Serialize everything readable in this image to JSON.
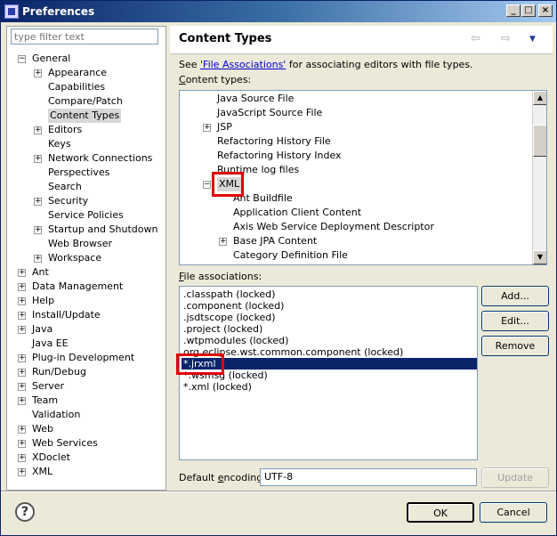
{
  "window": {
    "title": "Preferences",
    "controls": {
      "minimize": "_",
      "maximize": "□",
      "close": "×"
    }
  },
  "filter": {
    "placeholder": "type filter text"
  },
  "tree": [
    {
      "label": "General",
      "level": 0,
      "expander": "−"
    },
    {
      "label": "Appearance",
      "level": 1,
      "expander": "+"
    },
    {
      "label": "Capabilities",
      "level": 1,
      "expander": ""
    },
    {
      "label": "Compare/Patch",
      "level": 1,
      "expander": ""
    },
    {
      "label": "Content Types",
      "level": 1,
      "expander": "",
      "selected": true
    },
    {
      "label": "Editors",
      "level": 1,
      "expander": "+"
    },
    {
      "label": "Keys",
      "level": 1,
      "expander": ""
    },
    {
      "label": "Network Connections",
      "level": 1,
      "expander": "+"
    },
    {
      "label": "Perspectives",
      "level": 1,
      "expander": ""
    },
    {
      "label": "Search",
      "level": 1,
      "expander": ""
    },
    {
      "label": "Security",
      "level": 1,
      "expander": "+"
    },
    {
      "label": "Service Policies",
      "level": 1,
      "expander": ""
    },
    {
      "label": "Startup and Shutdown",
      "level": 1,
      "expander": "+"
    },
    {
      "label": "Web Browser",
      "level": 1,
      "expander": ""
    },
    {
      "label": "Workspace",
      "level": 1,
      "expander": "+"
    },
    {
      "label": "Ant",
      "level": 0,
      "expander": "+"
    },
    {
      "label": "Data Management",
      "level": 0,
      "expander": "+"
    },
    {
      "label": "Help",
      "level": 0,
      "expander": "+"
    },
    {
      "label": "Install/Update",
      "level": 0,
      "expander": "+"
    },
    {
      "label": "Java",
      "level": 0,
      "expander": "+"
    },
    {
      "label": "Java EE",
      "level": 0,
      "expander": ""
    },
    {
      "label": "Plug-in Development",
      "level": 0,
      "expander": "+"
    },
    {
      "label": "Run/Debug",
      "level": 0,
      "expander": "+"
    },
    {
      "label": "Server",
      "level": 0,
      "expander": "+"
    },
    {
      "label": "Team",
      "level": 0,
      "expander": "+"
    },
    {
      "label": "Validation",
      "level": 0,
      "expander": ""
    },
    {
      "label": "Web",
      "level": 0,
      "expander": "+"
    },
    {
      "label": "Web Services",
      "level": 0,
      "expander": "+"
    },
    {
      "label": "XDoclet",
      "level": 0,
      "expander": "+"
    },
    {
      "label": "XML",
      "level": 0,
      "expander": "+"
    }
  ],
  "page": {
    "title": "Content Types",
    "nav": {
      "back": "⇦",
      "forward": "⇨",
      "menu": "▼"
    },
    "see_prefix": "See ",
    "see_link": "'File Associations'",
    "see_suffix": " for associating editors with file types.",
    "content_types_label_pre": "",
    "content_types_label_u": "C",
    "content_types_label_rest": "ontent types:"
  },
  "content_types": [
    {
      "label": "Java Source File",
      "indent": 1,
      "expander": ""
    },
    {
      "label": "JavaScript Source File",
      "indent": 1,
      "expander": ""
    },
    {
      "label": "JSP",
      "indent": 1,
      "expander": "+"
    },
    {
      "label": "Refactoring History File",
      "indent": 1,
      "expander": ""
    },
    {
      "label": "Refactoring History Index",
      "indent": 1,
      "expander": ""
    },
    {
      "label": "Runtime log files",
      "indent": 1,
      "expander": ""
    },
    {
      "label": "XML",
      "indent": 1,
      "expander": "−",
      "selected": true
    },
    {
      "label": "Ant Buildfile",
      "indent": 2,
      "expander": ""
    },
    {
      "label": "Application Client Content",
      "indent": 2,
      "expander": ""
    },
    {
      "label": "Axis Web Service Deployment Descriptor",
      "indent": 2,
      "expander": ""
    },
    {
      "label": "Base JPA Content",
      "indent": 2,
      "expander": "+"
    },
    {
      "label": "Category Definition File",
      "indent": 2,
      "expander": ""
    }
  ],
  "file_assoc": {
    "label_u": "F",
    "label_rest": "ile associations:",
    "items": [
      ".classpath (locked)",
      ".component (locked)",
      ".jsdtscope (locked)",
      ".project (locked)",
      ".wtpmodules (locked)",
      "org.eclipse.wst.common.component (locked)",
      "*.jrxml",
      "*.wsmsg (locked)",
      "*.xml (locked)"
    ],
    "selected_index": 6
  },
  "buttons": {
    "add": "Add...",
    "edit": "Edit...",
    "remove": "Remove",
    "update": "Update",
    "ok": "OK",
    "cancel": "Cancel"
  },
  "encoding": {
    "label_pre": "Default ",
    "label_u": "e",
    "label_rest": "ncoding:",
    "value": "UTF-8"
  },
  "help_icon": "?",
  "colors": {
    "title_bar": "#0a246a",
    "selection": "#0a246a",
    "highlight_box": "#e00000",
    "link": "#0000d0"
  }
}
